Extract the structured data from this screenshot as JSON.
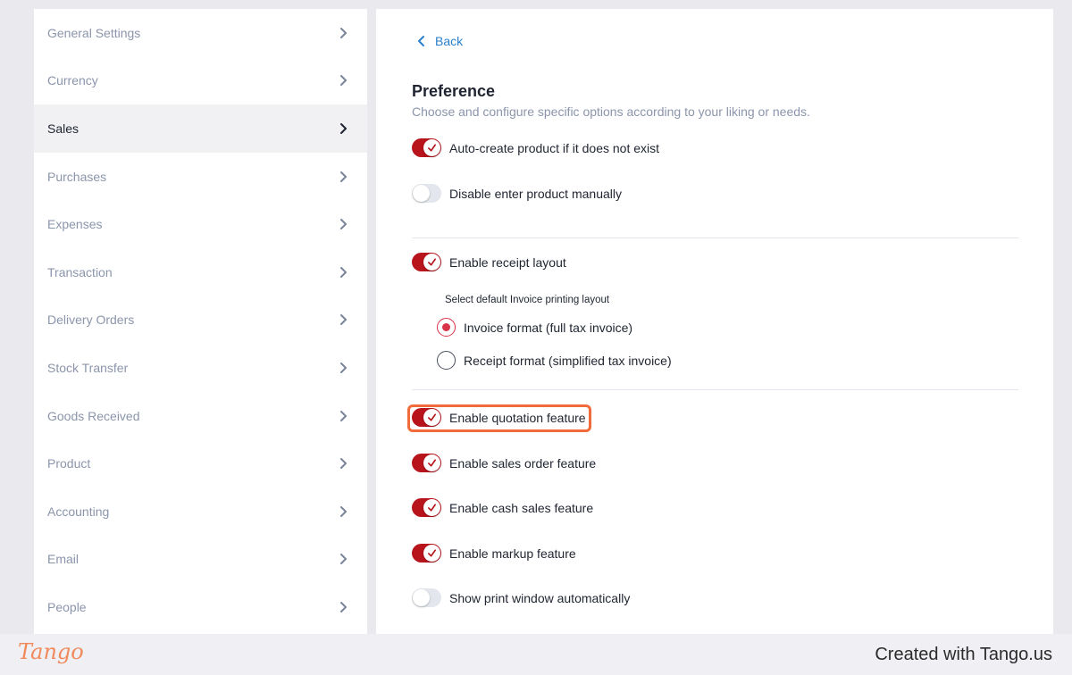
{
  "sidebar": {
    "items": [
      {
        "label": "General Settings",
        "active": false
      },
      {
        "label": "Currency",
        "active": false
      },
      {
        "label": "Sales",
        "active": true
      },
      {
        "label": "Purchases",
        "active": false
      },
      {
        "label": "Expenses",
        "active": false
      },
      {
        "label": "Transaction",
        "active": false
      },
      {
        "label": "Delivery Orders",
        "active": false
      },
      {
        "label": "Stock Transfer",
        "active": false
      },
      {
        "label": "Goods Received",
        "active": false
      },
      {
        "label": "Product",
        "active": false
      },
      {
        "label": "Accounting",
        "active": false
      },
      {
        "label": "Email",
        "active": false
      },
      {
        "label": "People",
        "active": false
      }
    ]
  },
  "main": {
    "back_label": "Back",
    "title": "Preference",
    "subtitle": "Choose and configure specific options according to your liking or needs.",
    "toggles": [
      {
        "label": "Auto-create product if it does not exist",
        "on": true
      },
      {
        "label": "Disable enter product manually",
        "on": false
      },
      {
        "label": "Enable receipt layout",
        "on": true
      },
      {
        "label": "Enable quotation feature",
        "on": true
      },
      {
        "label": "Enable sales order feature",
        "on": true
      },
      {
        "label": "Enable cash sales feature",
        "on": true
      },
      {
        "label": "Enable markup feature",
        "on": true
      },
      {
        "label": "Show print window automatically",
        "on": false
      }
    ],
    "invoice_layout": {
      "label": "Select default Invoice printing layout",
      "options": [
        {
          "label": "Invoice format (full tax invoice)",
          "selected": true
        },
        {
          "label": "Receipt format (simplified tax invoice)",
          "selected": false
        }
      ]
    }
  },
  "footer": {
    "logo": "Tango",
    "credit": "Created with Tango.us"
  },
  "colors": {
    "accent_red": "#b8141c",
    "link_blue": "#2a7fc9",
    "highlight_orange": "#f26b3a"
  }
}
